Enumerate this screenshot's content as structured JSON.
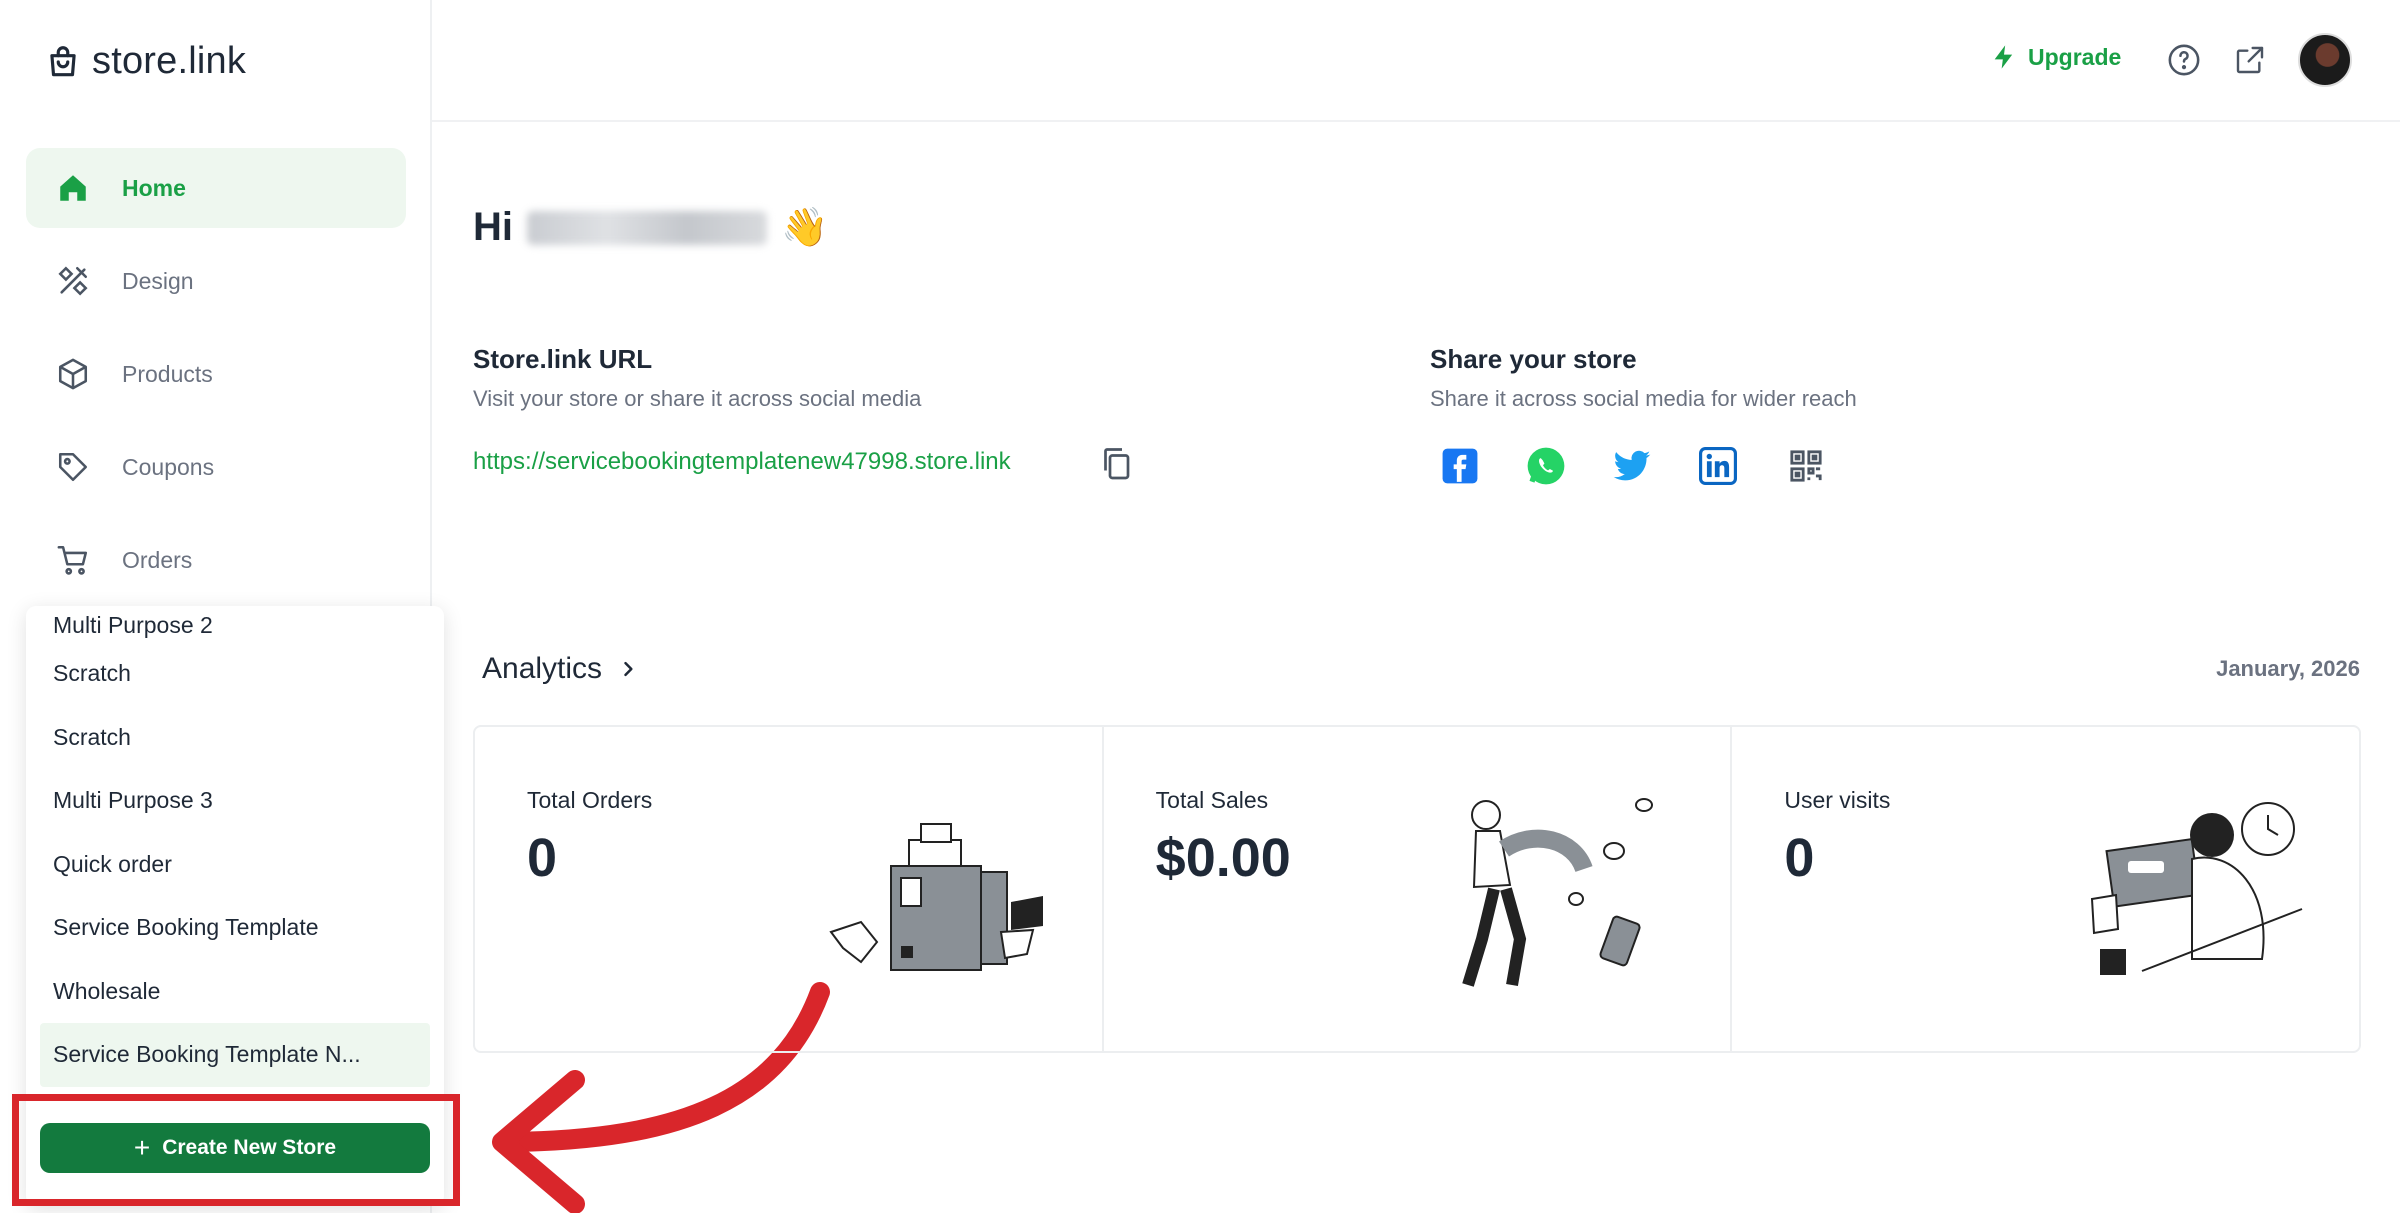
{
  "app": {
    "logo_text": "store.link"
  },
  "sidebar": {
    "nav": [
      {
        "label": "Home",
        "icon": "home-icon",
        "active": true
      },
      {
        "label": "Design",
        "icon": "design-tools-icon"
      },
      {
        "label": "Products",
        "icon": "box-icon"
      },
      {
        "label": "Coupons",
        "icon": "tag-icon"
      },
      {
        "label": "Orders",
        "icon": "cart-icon"
      }
    ]
  },
  "stores": {
    "items": [
      "Multi Purpose 2",
      "Scratch",
      "Scratch",
      "Multi Purpose 3",
      "Quick order",
      "Service Booking Template",
      "Wholesale",
      "Service Booking Template N..."
    ],
    "create_label": "Create New Store"
  },
  "header": {
    "upgrade_label": "Upgrade",
    "icons": [
      "lightning-icon",
      "help-circle-icon",
      "external-link-icon",
      "avatar"
    ]
  },
  "greeting": {
    "prefix": "Hi",
    "emoji": "👋"
  },
  "store_url": {
    "title": "Store.link URL",
    "subtitle": "Visit your store or share it across social media",
    "url": "https://servicebookingtemplatenew47998.store.link"
  },
  "share": {
    "title": "Share your store",
    "subtitle": "Share it across social media for wider reach",
    "icons": [
      "facebook-icon",
      "whatsapp-icon",
      "twitter-icon",
      "linkedin-icon",
      "qr-code-icon"
    ]
  },
  "analytics": {
    "title": "Analytics",
    "date": "January, 2026",
    "cards": [
      {
        "label": "Total Orders",
        "value": "0"
      },
      {
        "label": "Total Sales",
        "value": "$0.00"
      },
      {
        "label": "User visits",
        "value": "0"
      }
    ]
  },
  "colors": {
    "brand_green": "#1aa046",
    "button_green": "#137a3e",
    "annotation_red": "#d9262b"
  }
}
